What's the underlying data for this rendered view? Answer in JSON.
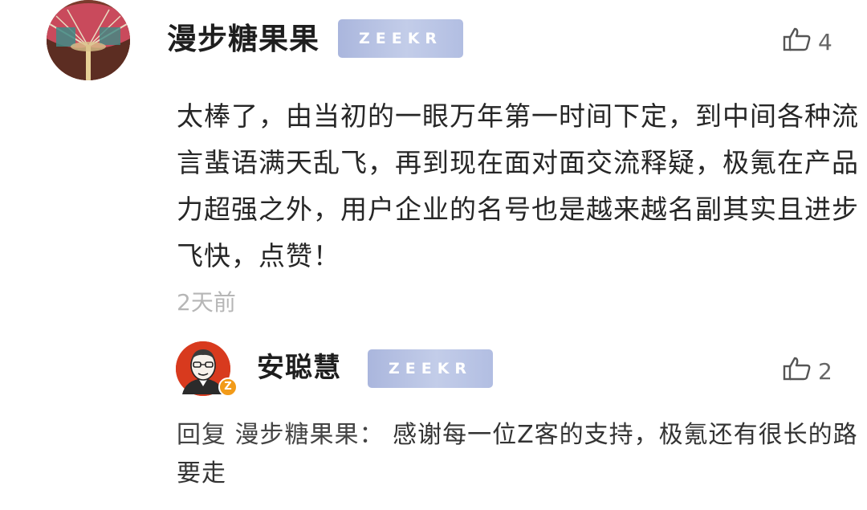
{
  "comment": {
    "username": "漫步糖果果",
    "badge": "ZEEKR",
    "like_count": "4",
    "text": "太棒了，由当初的一眼万年第一时间下定，到中间各种流言蜚语满天乱飞，再到现在面对面交流释疑，极氪在产品力超强之外，用户企业的名号也是越来越名副其实且进步飞快，点赞！",
    "time": "2天前",
    "avatar_icon": "fan-avatar"
  },
  "reply": {
    "username": "安聪慧",
    "badge": "ZEEKR",
    "like_count": "2",
    "reply_prefix": "回复 漫步糖果果：",
    "text": "感谢每一位Z客的支持，极氪还有很长的路要走",
    "verified_badge": "Z",
    "avatar_icon": "person-cartoon-avatar"
  },
  "colors": {
    "badge": "#b9c4e6",
    "time": "#b6b6b6",
    "reply_avatar_bg": "#d83a1e",
    "verified": "#f29b19"
  },
  "icons": {
    "like": "thumbs-up-icon"
  }
}
